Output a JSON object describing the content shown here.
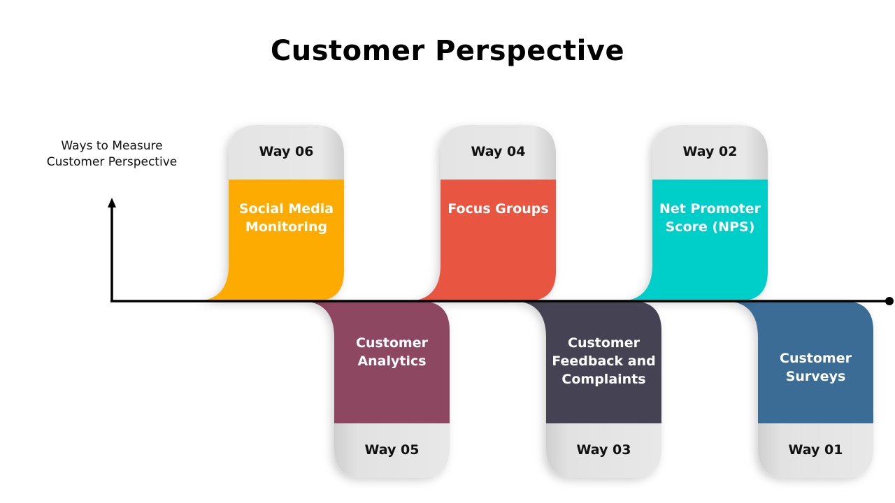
{
  "title": "Customer Perspective",
  "axis_label": "Ways to Measure Customer Perspective",
  "colors": {
    "tab_gray": "#e6e6e6",
    "axis": "#000000"
  },
  "ways": [
    {
      "way": "Way 01",
      "label": "Customer Surveys",
      "color": "#3b6c96",
      "position": "below"
    },
    {
      "way": "Way 02",
      "label": "Net Promoter Score (NPS)",
      "color": "#00cec9",
      "position": "above"
    },
    {
      "way": "Way 03",
      "label": "Customer Feedback and Complaints",
      "color": "#454353",
      "position": "below"
    },
    {
      "way": "Way 04",
      "label": "Focus Groups",
      "color": "#e85541",
      "position": "above"
    },
    {
      "way": "Way 05",
      "label": "Customer Analytics",
      "color": "#8e4660",
      "position": "below"
    },
    {
      "way": "Way 06",
      "label": "Social Media Monitoring",
      "color": "#fdab00",
      "position": "above"
    }
  ]
}
